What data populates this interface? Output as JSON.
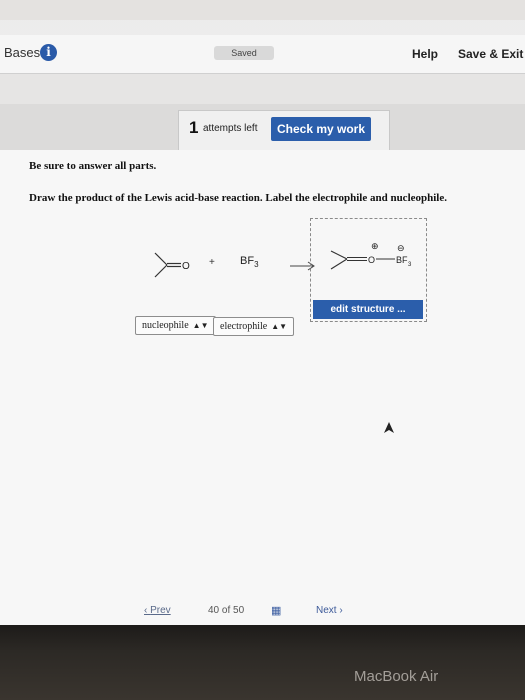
{
  "header": {
    "app_title": "Bases",
    "info_icon": "i",
    "saved_status": "Saved",
    "help_label": "Help",
    "save_exit_label": "Save & Exit"
  },
  "attempts": {
    "count": "1",
    "label": "attempts left",
    "check_button": "Check my work"
  },
  "question": {
    "instruction_1": "Be sure to answer all parts.",
    "instruction_2": "Draw the product of the Lewis acid-base reaction. Label the electrophile and nucleophile."
  },
  "reaction": {
    "reactant_atom": "O",
    "plus": "+",
    "lewis_acid": "BF",
    "lewis_acid_sub": "3",
    "product_o": "O",
    "product_b": "BF",
    "product_b_sub": "3",
    "charge_minus": "⊖",
    "charge_plus": "⊕",
    "edit_button": "edit structure ..."
  },
  "labels": {
    "nucleophile": "nucleophile",
    "electrophile": "electrophile",
    "selector_arrows": "▲▼"
  },
  "pager": {
    "prev": "Prev",
    "page_current": "40",
    "of": "of",
    "page_total": "50",
    "next": "Next"
  },
  "device": {
    "label": "MacBook Air"
  }
}
